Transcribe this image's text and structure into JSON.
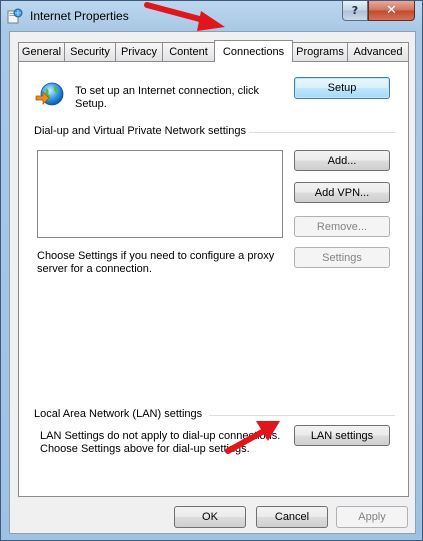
{
  "window": {
    "title": "Internet Properties",
    "help_glyph": "?",
    "close_glyph": "✕"
  },
  "tabs": [
    {
      "label": "General"
    },
    {
      "label": "Security"
    },
    {
      "label": "Privacy"
    },
    {
      "label": "Content"
    },
    {
      "label": "Connections"
    },
    {
      "label": "Programs"
    },
    {
      "label": "Advanced"
    }
  ],
  "active_tab": "Connections",
  "setup": {
    "text_line1": "To set up an Internet connection, click",
    "text_line2": "Setup.",
    "button": "Setup"
  },
  "dialup": {
    "group_title": "Dial-up and Virtual Private Network settings",
    "buttons": {
      "add": "Add...",
      "add_vpn": "Add VPN...",
      "remove": "Remove...",
      "settings": "Settings"
    },
    "proxy_text_line1": "Choose Settings if you need to configure a proxy",
    "proxy_text_line2": "server for a connection."
  },
  "lan": {
    "group_title": "Local Area Network (LAN) settings",
    "text_line1": "LAN Settings do not apply to dial-up connections.",
    "text_line2": "Choose Settings above for dial-up settings.",
    "button": "LAN settings"
  },
  "footer": {
    "ok": "OK",
    "cancel": "Cancel",
    "apply": "Apply"
  },
  "colors": {
    "annotation_arrow": "#e0161b"
  }
}
